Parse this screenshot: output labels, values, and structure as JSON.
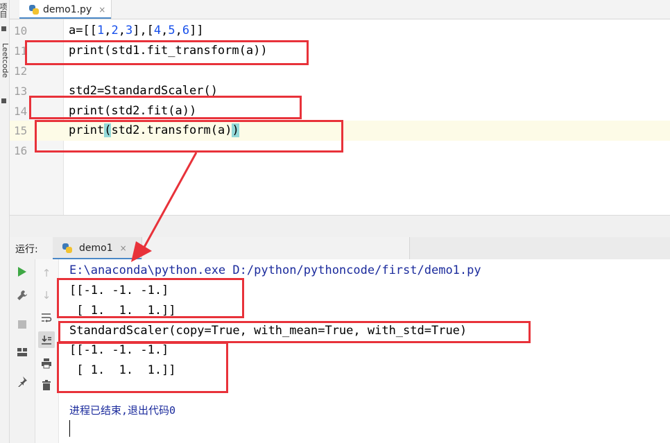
{
  "sidebar": {
    "top_label": "项目",
    "leetcode_label": "Leetcode"
  },
  "editor_tab": {
    "label": "demo1.py",
    "close": "×"
  },
  "editor": {
    "lines": [
      {
        "n": "10",
        "code": "a=[[1,2,3],[4,5,6]]"
      },
      {
        "n": "11",
        "code": "print(std1.fit_transform(a))"
      },
      {
        "n": "12",
        "code": ""
      },
      {
        "n": "13",
        "code": "std2=StandardScaler()"
      },
      {
        "n": "14",
        "code": "print(std2.fit(a))"
      },
      {
        "n": "15",
        "code": "print(std2.transform(a))"
      },
      {
        "n": "16",
        "code": ""
      }
    ],
    "current_line": "15"
  },
  "run_panel": {
    "label": "运行:",
    "tab_label": "demo1",
    "close": "×"
  },
  "console": {
    "lines": [
      "E:\\anaconda\\python.exe D:/python/pythoncode/first/demo1.py",
      "[[-1. -1. -1.]",
      " [ 1.  1.  1.]]",
      "StandardScaler(copy=True, with_mean=True, with_std=True)",
      "[[-1. -1. -1.]",
      " [ 1.  1.  1.]]",
      "",
      "进程已结束,退出代码0"
    ]
  },
  "colors": {
    "annotation": "#e8323a",
    "number": "#1750eb",
    "path": "#1a2a9c",
    "bracket_highlight": "#93d9d9",
    "run_green": "#3fa845"
  },
  "icons": {
    "run": "play-icon",
    "settings": "wrench-icon",
    "stop": "stop-icon",
    "layout": "layout-icon",
    "pin": "pin-icon",
    "up": "arrow-up-icon",
    "down": "arrow-down-icon",
    "wrap": "soft-wrap-icon",
    "scroll": "scroll-to-end-icon",
    "print": "print-icon",
    "trash": "trash-icon"
  }
}
